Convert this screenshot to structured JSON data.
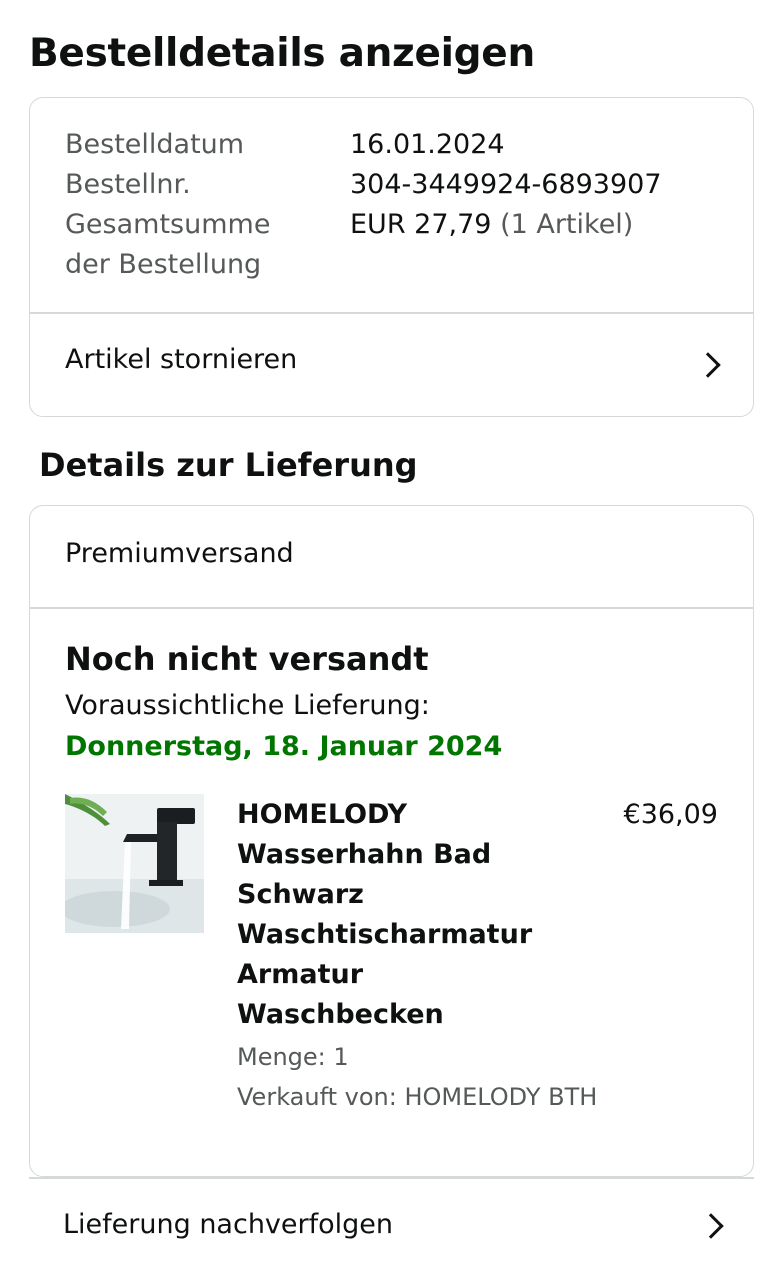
{
  "page_title": "Bestelldetails anzeigen",
  "order_summary": {
    "date_label": "Bestelldatum",
    "date_value": "16.01.2024",
    "order_no_label": "Bestellnr.",
    "order_no_value": "304-3449924-6893907",
    "total_label_line1": "Gesamtsumme",
    "total_label_line2": "der Bestellung",
    "total_value": "EUR 27,79",
    "total_items": "(1 Artikel)",
    "cancel_action": "Artikel stornieren"
  },
  "delivery": {
    "section_title": "Details zur Lieferung",
    "shipping_method": "Premiumversand",
    "status": "Noch nicht versandt",
    "eta_label": "Voraussichtliche Lieferung:",
    "eta_date": "Donnerstag, 18. Januar 2024",
    "eta_color": "#007600",
    "item": {
      "title_lines": [
        "HOMELODY",
        "Wasserhahn Bad",
        "Schwarz",
        "Waschtischarmatur",
        "Armatur",
        "Waschbecken"
      ],
      "price": "€36,09",
      "quantity": "Menge: 1",
      "seller": "Verkauft von: HOMELODY BTH"
    },
    "track_action": "Lieferung nachverfolgen"
  },
  "icons": {
    "chevron": "chevron-right-icon"
  }
}
